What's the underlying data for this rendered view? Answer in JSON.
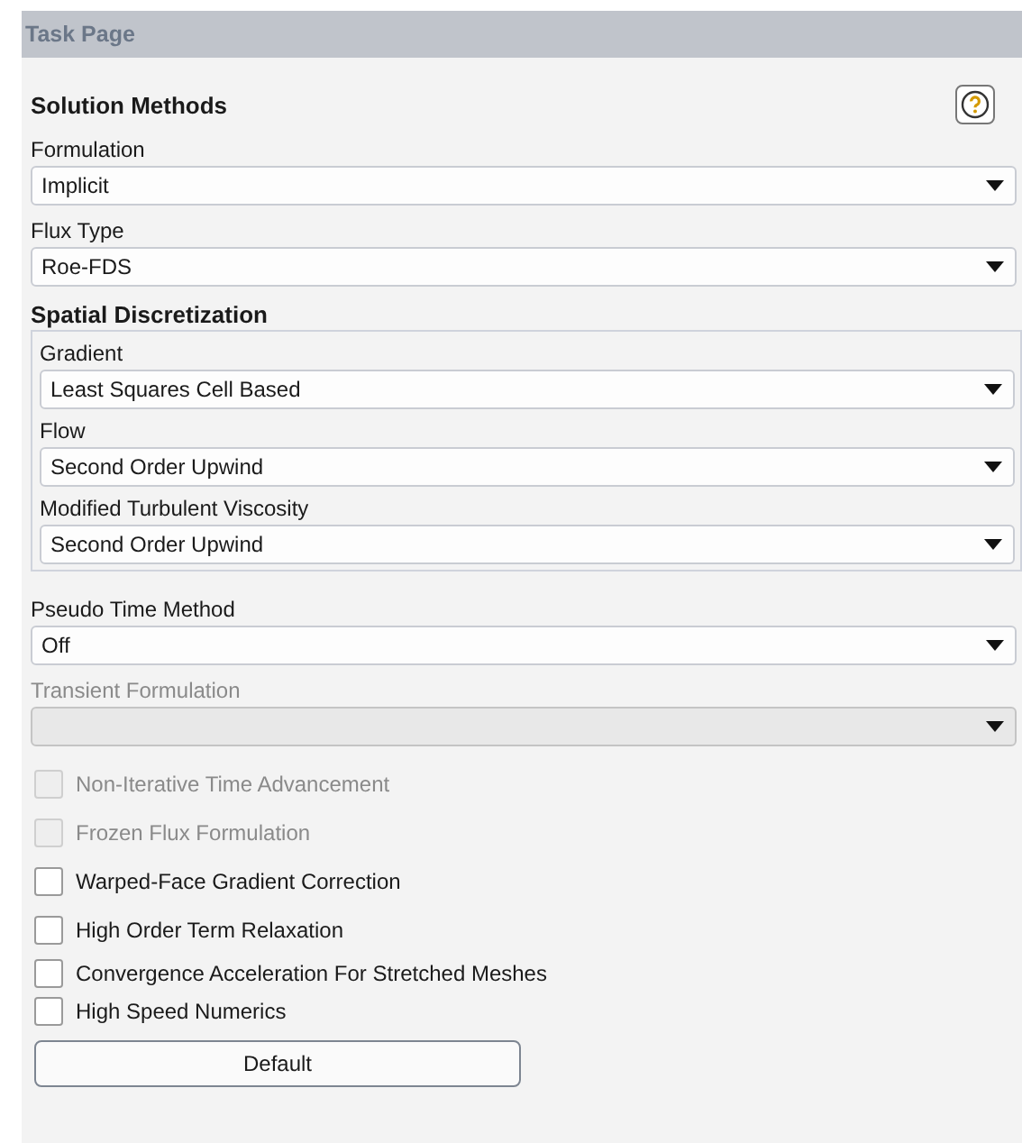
{
  "title": "Task Page",
  "section": {
    "title": "Solution Methods"
  },
  "fields": [
    {
      "kind": "dropdown",
      "label": "Formulation",
      "value": "Implicit",
      "disabled": false
    },
    {
      "kind": "dropdown",
      "label": "Flux Type",
      "value": "Roe-FDS",
      "disabled": false
    },
    {
      "kind": "group",
      "title": "Spatial Discretization",
      "children": [
        {
          "kind": "dropdown",
          "label": "Gradient",
          "value": "Least Squares Cell Based",
          "disabled": false
        },
        {
          "kind": "dropdown",
          "label": "Flow",
          "value": "Second Order Upwind",
          "disabled": false
        },
        {
          "kind": "dropdown",
          "label": "Modified Turbulent Viscosity",
          "value": "Second Order Upwind",
          "disabled": false
        }
      ]
    },
    {
      "kind": "dropdown",
      "label": "Pseudo Time Method",
      "value": "Off",
      "disabled": false
    },
    {
      "kind": "dropdown",
      "label": "Transient Formulation",
      "disabled": true
    }
  ],
  "checkboxes": [
    {
      "label": "Non-Iterative Time Advancement",
      "checked": false,
      "disabled": true
    },
    {
      "label": "Frozen Flux Formulation",
      "checked": false,
      "disabled": true
    },
    {
      "label": "Warped-Face Gradient Correction",
      "checked": false,
      "disabled": false
    },
    {
      "label": "High Order Term Relaxation",
      "checked": false,
      "disabled": false
    },
    {
      "label": "Convergence Acceleration For Stretched Meshes",
      "checked": false,
      "disabled": false
    },
    {
      "label": "High Speed Numerics",
      "checked": false,
      "disabled": false
    }
  ],
  "button": "Default"
}
